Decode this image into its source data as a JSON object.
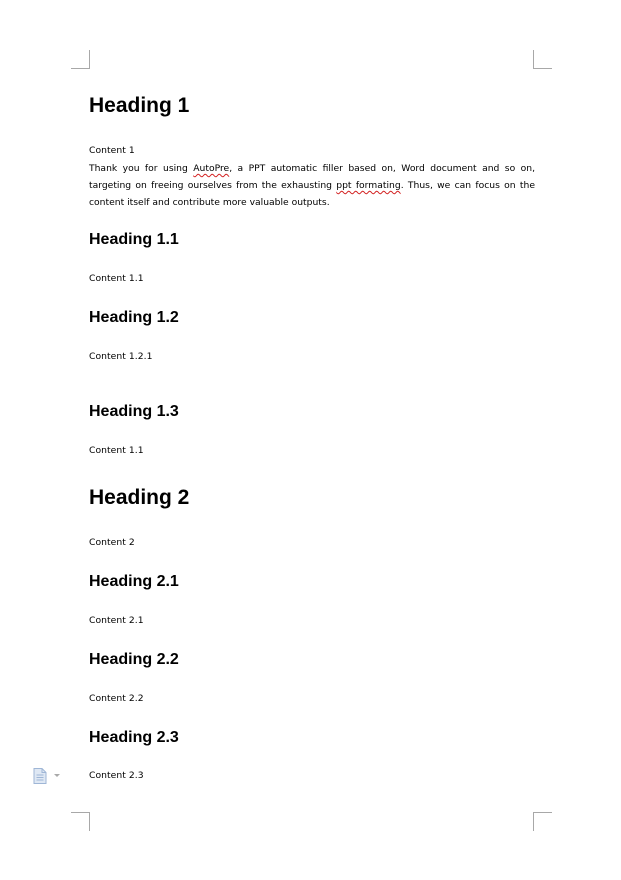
{
  "document": {
    "blocks": [
      {
        "kind": "h1",
        "text": "Heading 1"
      },
      {
        "kind": "p",
        "text": "Content 1"
      },
      {
        "kind": "para",
        "lines": [
          [
            "Thank you for using ",
            {
              "err": "AutoPre"
            },
            ", a PPT automatic filler based on, Word document and so on,"
          ],
          [
            "targeting on freeing ourselves from the exhausting ",
            {
              "err": "ppt formating"
            },
            ". Thus, we can focus on the"
          ],
          [
            "content itself and contribute more valuable outputs."
          ]
        ]
      },
      {
        "kind": "h2",
        "text": "Heading 1.1"
      },
      {
        "kind": "p",
        "text": "Content 1.1"
      },
      {
        "kind": "h2",
        "text": "Heading 1.2"
      },
      {
        "kind": "p",
        "text": "Content 1.2.1"
      },
      {
        "kind": "h2",
        "text": "Heading 1.3"
      },
      {
        "kind": "p",
        "text": "Content 1.1"
      },
      {
        "kind": "h1",
        "text": "Heading 2"
      },
      {
        "kind": "p",
        "text": "Content 2"
      },
      {
        "kind": "h2",
        "text": "Heading 2.1"
      },
      {
        "kind": "p",
        "text": "Content 2.1"
      },
      {
        "kind": "h2",
        "text": "Heading 2.2"
      },
      {
        "kind": "p",
        "text": "Content 2.2"
      },
      {
        "kind": "h2",
        "text": "Heading 2.3"
      },
      {
        "kind": "p",
        "text": "Content 2.3"
      }
    ]
  },
  "paste_options": {
    "icon": "paste-options-icon",
    "dropdown_icon": "chevron-down-icon",
    "color": "#9fb6d6"
  },
  "colors": {
    "spell_error": "#d21f1f",
    "margin_marks": "#a8a8a8"
  }
}
